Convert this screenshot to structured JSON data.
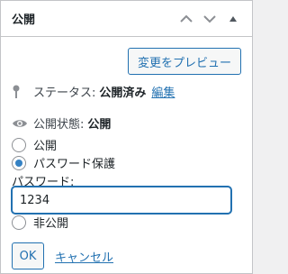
{
  "header": {
    "title": "公開",
    "controls": [
      "chevron-up-icon",
      "chevron-down-icon",
      "caret-up-icon"
    ]
  },
  "preview": {
    "label": "変更をプレビュー"
  },
  "status": {
    "label": "ステータス:",
    "value": "公開済み",
    "edit": "編集",
    "icon": "pin-icon"
  },
  "visibility": {
    "label": "公開状態:",
    "value": "公開",
    "icon": "eye-icon"
  },
  "options": {
    "public": "公開",
    "password": "パスワード保護",
    "private": "非公開",
    "selected": "password"
  },
  "password": {
    "label": "パスワード:",
    "value": "1234"
  },
  "actions": {
    "ok": "OK",
    "cancel": "キャンセル"
  },
  "colors": {
    "accent": "#2271b1",
    "radio": "#3582c4",
    "border": "#c3c4c7"
  }
}
